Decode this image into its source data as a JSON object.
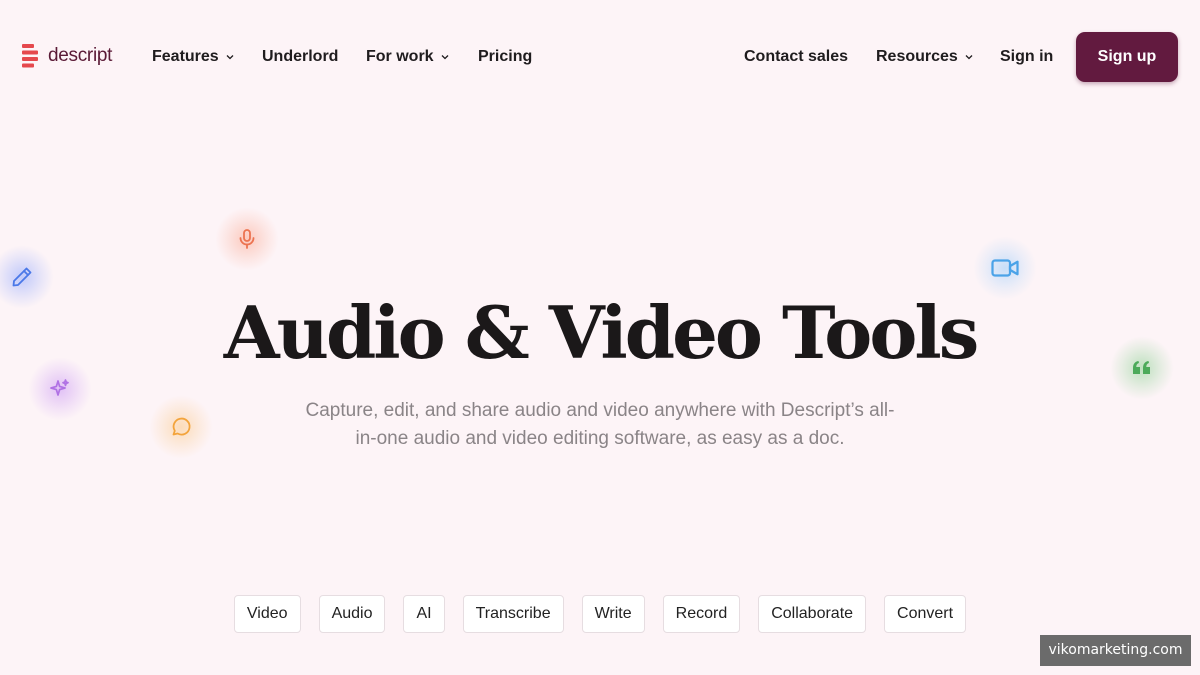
{
  "brand": {
    "name": "descript",
    "accent": "#e5484d",
    "primary": "#621a3f"
  },
  "nav": {
    "left_items": [
      {
        "label": "Features",
        "has_dropdown": true
      },
      {
        "label": "Underlord",
        "has_dropdown": false
      },
      {
        "label": "For work",
        "has_dropdown": true
      },
      {
        "label": "Pricing",
        "has_dropdown": false
      }
    ],
    "right_items": [
      {
        "label": "Contact sales",
        "has_dropdown": false
      },
      {
        "label": "Resources",
        "has_dropdown": true
      },
      {
        "label": "Sign in",
        "has_dropdown": false
      }
    ],
    "signup_label": "Sign up"
  },
  "hero": {
    "title": "Audio & Video Tools",
    "subtitle": "Capture, edit, and share audio and video anywhere with Descript’s all-in-one audio and video editing software, as easy as a doc."
  },
  "floating_icons": [
    {
      "name": "pencil-icon",
      "color": "#4a78e8"
    },
    {
      "name": "microphone-icon",
      "color": "#ec7350"
    },
    {
      "name": "sparkle-icon",
      "color": "#b071e4"
    },
    {
      "name": "chat-bubble-icon",
      "color": "#f3a43c"
    },
    {
      "name": "video-camera-icon",
      "color": "#4ba3e8"
    },
    {
      "name": "quote-icon",
      "color": "#4caa5a"
    }
  ],
  "tags": [
    "Video",
    "Audio",
    "AI",
    "Transcribe",
    "Write",
    "Record",
    "Collaborate",
    "Convert"
  ],
  "watermark": "vikomarketing.com"
}
